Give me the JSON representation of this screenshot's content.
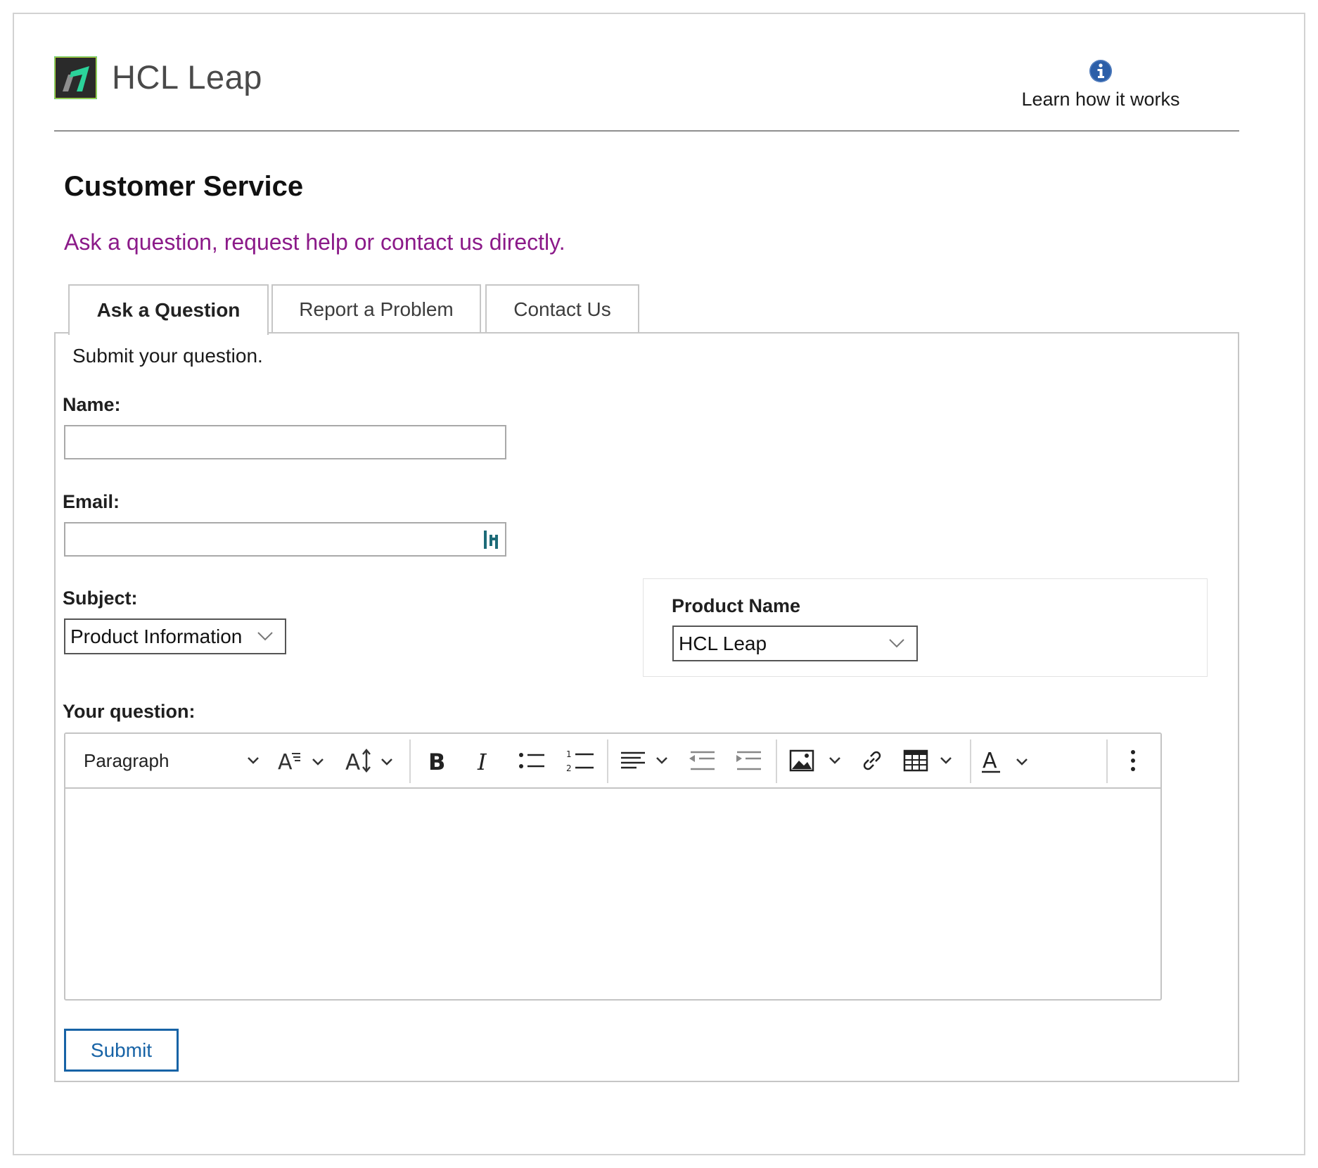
{
  "header": {
    "brand_name": "HCL Leap",
    "learn_link": "Learn how it works"
  },
  "page": {
    "title": "Customer Service",
    "subtitle": "Ask a question, request help or contact us directly."
  },
  "tabs": [
    {
      "label": "Ask a Question",
      "active": true
    },
    {
      "label": "Report a Problem",
      "active": false
    },
    {
      "label": "Contact Us",
      "active": false
    }
  ],
  "form": {
    "intro": "Submit your question.",
    "name_label": "Name:",
    "name_value": "",
    "email_label": "Email:",
    "email_value": "",
    "subject_label": "Subject:",
    "subject_value": "Product Information",
    "product_label": "Product Name",
    "product_value": "HCL Leap",
    "question_label": "Your question:",
    "submit_label": "Submit"
  },
  "editor_toolbar": {
    "paragraph_label": "Paragraph",
    "tools": [
      "paragraph-format",
      "font-family",
      "font-size",
      "bold",
      "italic",
      "bulleted-list",
      "numbered-list",
      "alignment",
      "outdent",
      "indent",
      "insert-image",
      "link",
      "insert-table",
      "font-color",
      "more-options"
    ]
  },
  "colors": {
    "subtitle": "#8b1a89",
    "submit_border": "#1763a6",
    "info_icon": "#2c5fa8",
    "logo_green": "#2bd39a",
    "logo_dark": "#2a2a2a"
  }
}
